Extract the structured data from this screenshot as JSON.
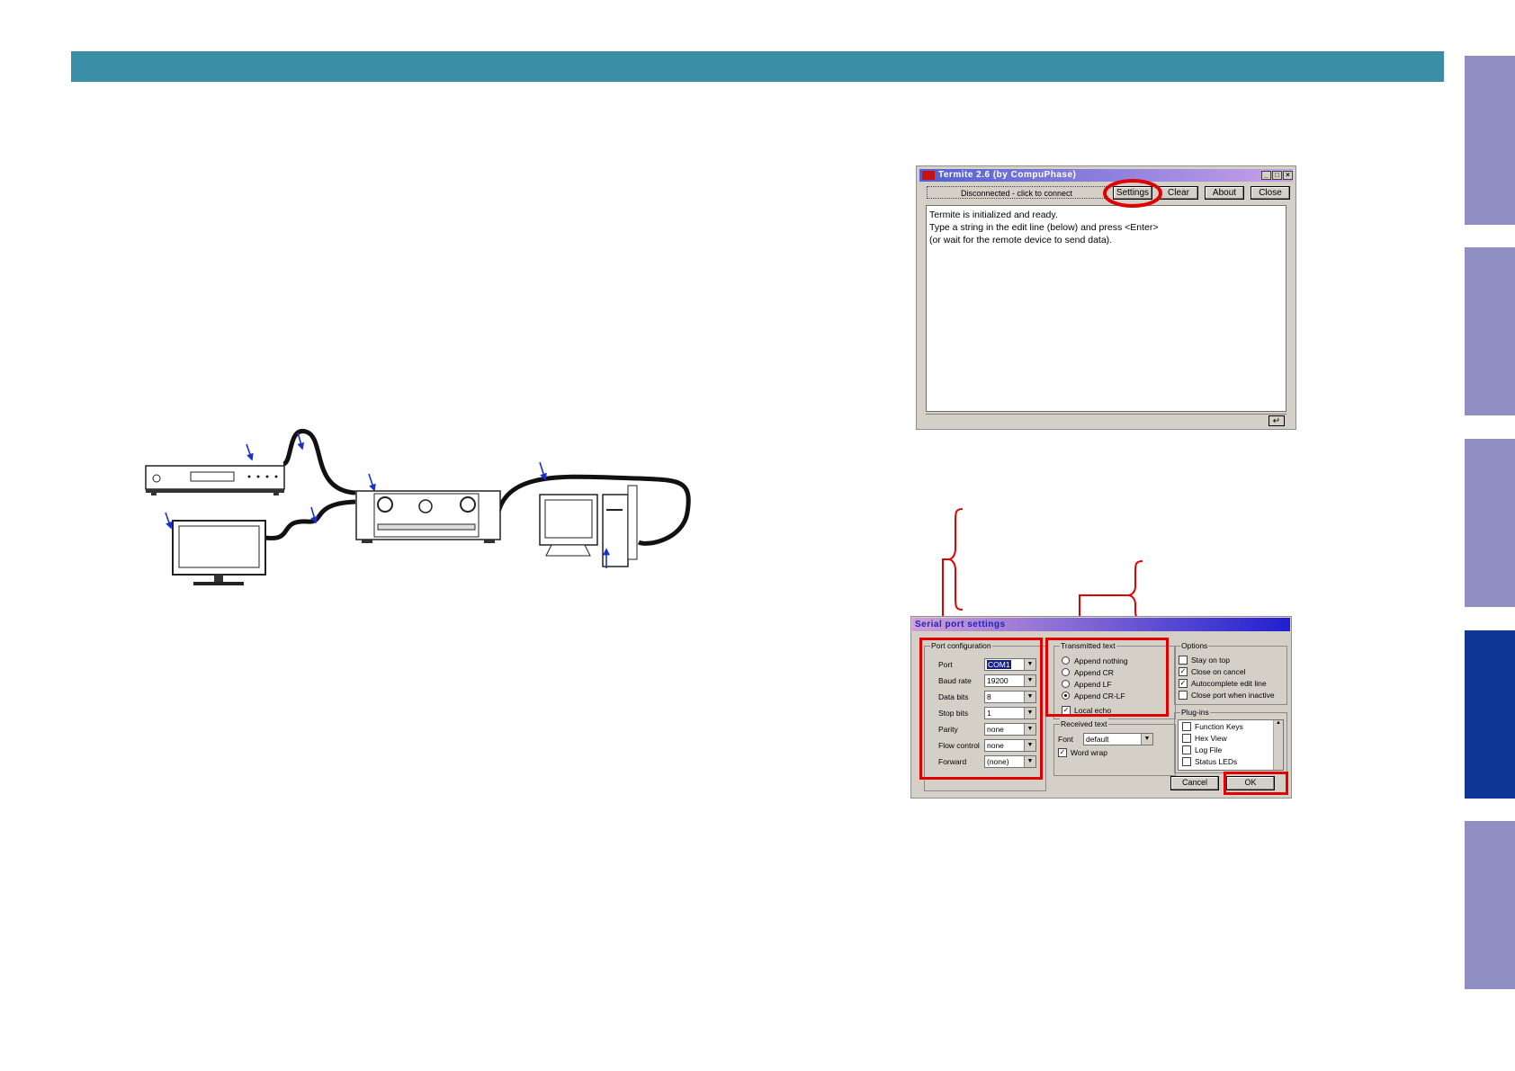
{
  "termite": {
    "title": "Termite 2.6  (by CompuPhase)",
    "status": "Disconnected - click to connect",
    "buttons": {
      "settings": "Settings",
      "clear": "Clear",
      "about": "About",
      "close": "Close"
    },
    "output_lines": [
      "Termite is initialized and ready.",
      "Type a string in the edit line (below) and press <Enter>",
      "(or wait for the remote device to send data)."
    ],
    "enter_glyph": "↵"
  },
  "serial_settings": {
    "title": "Serial port settings",
    "port_config": {
      "legend": "Port configuration",
      "rows": [
        {
          "label": "Port",
          "value": "COM1"
        },
        {
          "label": "Baud rate",
          "value": "19200"
        },
        {
          "label": "Data bits",
          "value": "8"
        },
        {
          "label": "Stop bits",
          "value": "1"
        },
        {
          "label": "Parity",
          "value": "none"
        },
        {
          "label": "Flow control",
          "value": "none"
        },
        {
          "label": "Forward",
          "value": "(none)"
        }
      ]
    },
    "transmitted_text": {
      "legend": "Transmitted text",
      "options": [
        "Append nothing",
        "Append CR",
        "Append LF",
        "Append CR-LF"
      ],
      "selected": "Append CR-LF",
      "local_echo": "Local echo",
      "local_echo_checked": true
    },
    "received_text": {
      "legend": "Received text",
      "font_label": "Font",
      "font_value": "default",
      "word_wrap": "Word wrap",
      "word_wrap_checked": true
    },
    "options": {
      "legend": "Options",
      "items": [
        {
          "label": "Stay on top",
          "checked": false
        },
        {
          "label": "Close on cancel",
          "checked": true
        },
        {
          "label": "Autocomplete edit line",
          "checked": true
        },
        {
          "label": "Close port when inactive",
          "checked": false
        }
      ]
    },
    "plugins": {
      "legend": "Plug-ins",
      "items": [
        "Function Keys",
        "Hex View",
        "Log File",
        "Status LEDs"
      ]
    },
    "cancel_label": "Cancel",
    "ok_label": "OK"
  },
  "colors": {
    "header_bar": "#3a8fa6",
    "side_tab": "#8f8fc4",
    "side_tab_active": "#0e3797",
    "highlight": "#e00000",
    "arrow": "#1a2fd0"
  },
  "icons": [
    "cd-player-icon",
    "tv-icon",
    "av-receiver-icon",
    "pc-icon",
    "minimize-icon",
    "maximize-icon",
    "close-icon",
    "enter-icon"
  ]
}
